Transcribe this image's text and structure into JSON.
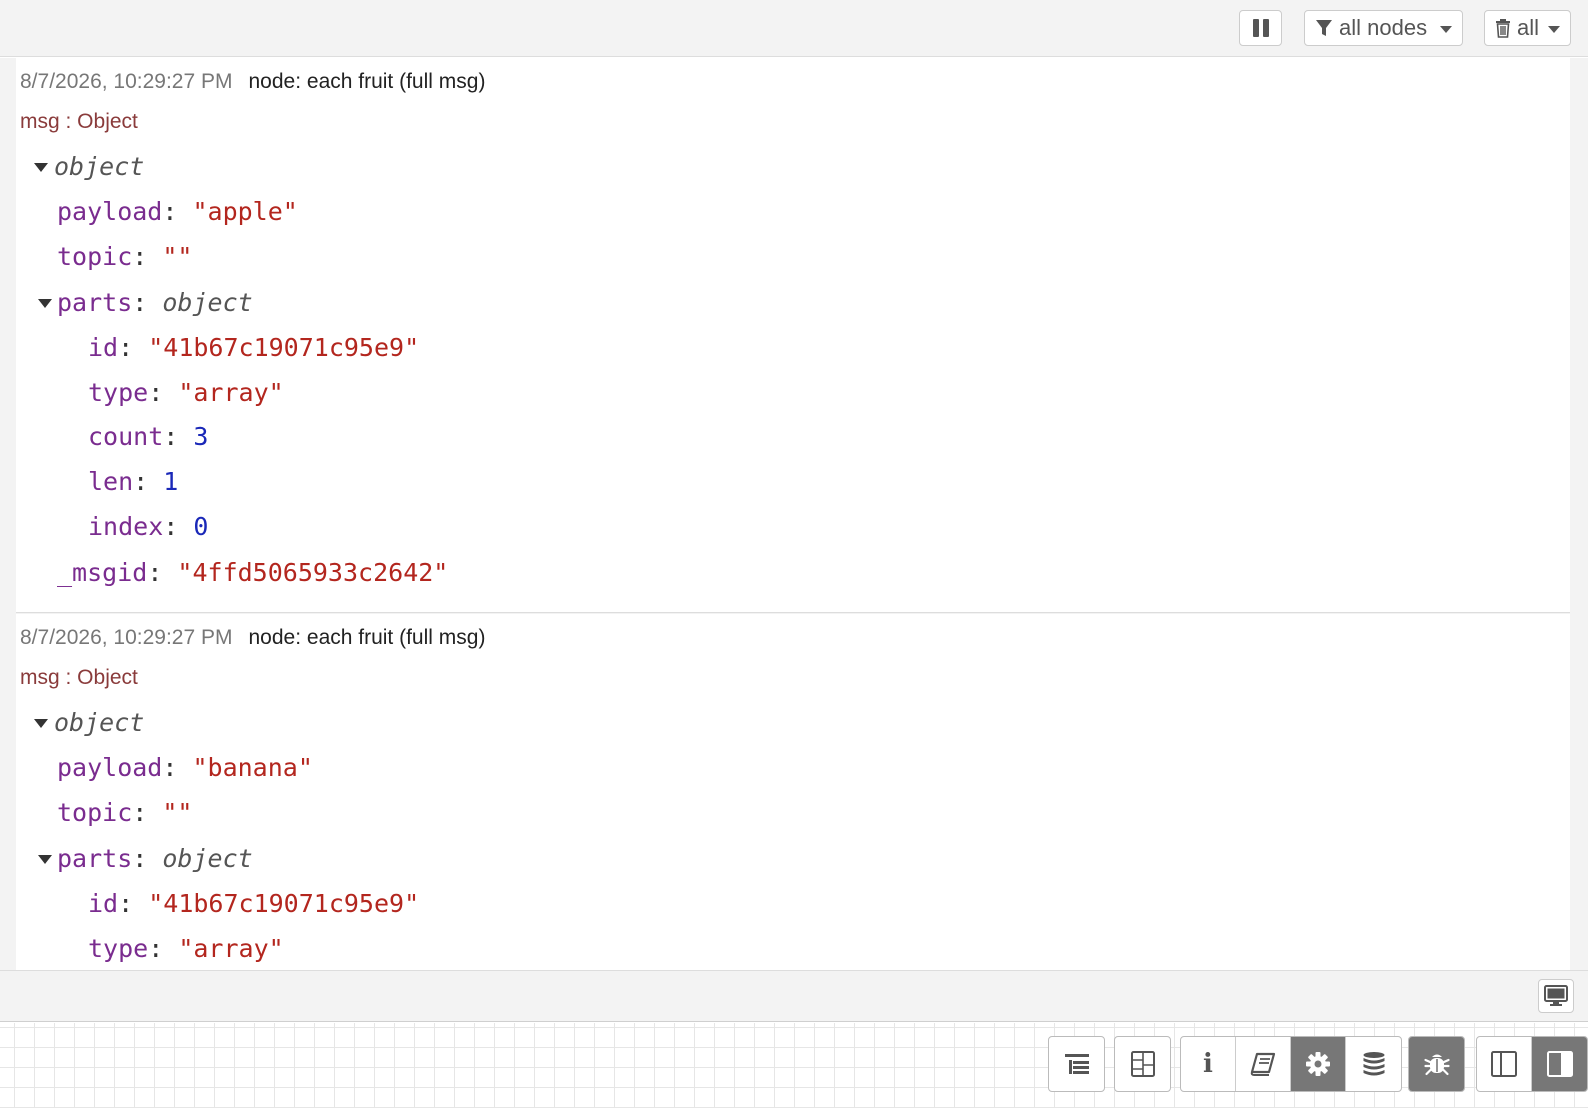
{
  "toolbar": {
    "pause_icon": "pause-icon",
    "filter_icon": "filter-icon",
    "filter_label": "all nodes",
    "clear_icon": "trash-icon",
    "clear_label": "all"
  },
  "messages": [
    {
      "timestamp": "8/7/2026, 10:29:27 PM",
      "node": "node: each fruit (full msg)",
      "msg_type": "msg : Object",
      "root_type": "object",
      "payload_key": "payload",
      "payload_value": "\"apple\"",
      "topic_key": "topic",
      "topic_value": "\"\"",
      "parts_key": "parts",
      "parts_type": "object",
      "id_key": "id",
      "id_value": "\"41b67c19071c95e9\"",
      "type_key": "type",
      "type_value": "\"array\"",
      "count_key": "count",
      "count_value": "3",
      "len_key": "len",
      "len_value": "1",
      "index_key": "index",
      "index_value": "0",
      "msgid_key": "_msgid",
      "msgid_value": "\"4ffd5065933c2642\""
    },
    {
      "timestamp": "8/7/2026, 10:29:27 PM",
      "node": "node: each fruit (full msg)",
      "msg_type": "msg : Object",
      "root_type": "object",
      "payload_key": "payload",
      "payload_value": "\"banana\"",
      "topic_key": "topic",
      "topic_value": "\"\"",
      "parts_key": "parts",
      "parts_type": "object",
      "id_key": "id",
      "id_value": "\"41b67c19071c95e9\"",
      "type_key": "type",
      "type_value": "\"array\""
    }
  ],
  "status_strip": {
    "monitor_icon": "monitor-icon"
  },
  "sidebar_tabs": [
    {
      "icon": "outline-icon",
      "active": false
    },
    {
      "icon": "layout-icon",
      "active": false
    },
    {
      "icon": "info-icon",
      "active": false
    },
    {
      "icon": "book-icon",
      "active": false
    },
    {
      "icon": "gear-icon",
      "active": true
    },
    {
      "icon": "database-icon",
      "active": false
    },
    {
      "icon": "bug-icon",
      "active": true
    },
    {
      "icon": "sidebar-left-icon",
      "active": false
    },
    {
      "icon": "sidebar-right-icon",
      "active": true
    }
  ]
}
